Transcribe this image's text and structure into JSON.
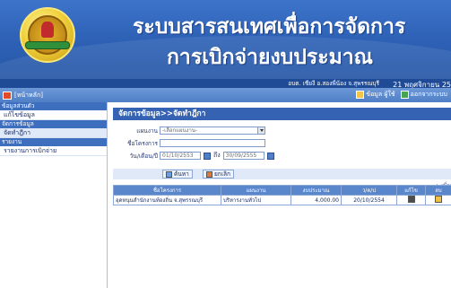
{
  "header": {
    "title_line1": "ระบบสารสนเทศเพื่อการจัดการ",
    "title_line2": "การเบิกจ่ายงบประมาณ",
    "user_info": "อบต. เชียงี อ.สองพี่น้อง จ.สุพรรณบุรี",
    "date_time": "21 พฤศจิกายน 25"
  },
  "toolbar": {
    "home_label": "[หน้าหลัก]",
    "profile_label": "ข้อมูล ผู้ใช้",
    "logout_label": "ออกจากระบบ"
  },
  "sidebar": {
    "sections": [
      {
        "heading": "ข้อมูลส่วนตัว",
        "items": [
          {
            "label": "แก้ไขข้อมูล",
            "active": false
          }
        ]
      },
      {
        "heading": "จัดการข้อมูล",
        "items": [
          {
            "label": "จัดทำฎีกา",
            "active": true
          }
        ]
      },
      {
        "heading": "รายงาน",
        "items": [
          {
            "label": "รายงานการเบิกจ่าย",
            "active": false
          }
        ]
      }
    ]
  },
  "main": {
    "breadcrumb": "จัดการข้อมูล>>จัดทำฎีกา",
    "form": {
      "plan_label": "แผนงาน",
      "plan_value": "-เลือกแผนงาน-",
      "project_label": "ชื่อโครงการ",
      "project_value": "",
      "date_label": "วัน/เดือน/ปี",
      "date_from": "01/10/2553",
      "date_to_label": "ถึง",
      "date_to": "30/09/2555"
    },
    "buttons": {
      "search": "ค้นหา",
      "cancel": "ยกเลิก"
    },
    "add_link": "+ เพิ่ม",
    "table": {
      "headers": [
        "ชื่อโครงการ",
        "แผนงาน",
        "งบประมาณ",
        "ว/ด/ป",
        "แก้ไข",
        "ลบ"
      ],
      "rows": [
        {
          "project": "อุดหนุนสำนักงานท้องถิ่น จ.สุพรรณบุรี",
          "plan": "บริหารงานทั่วไป",
          "budget": "4,000.00",
          "date": "20/10/2554"
        }
      ]
    }
  },
  "icons": [
    "emblem-logo",
    "home-icon",
    "user-icon",
    "logout-icon",
    "calendar-icon",
    "search-icon",
    "cancel-icon",
    "edit-icon",
    "delete-icon",
    "dropdown-arrow-icon"
  ]
}
